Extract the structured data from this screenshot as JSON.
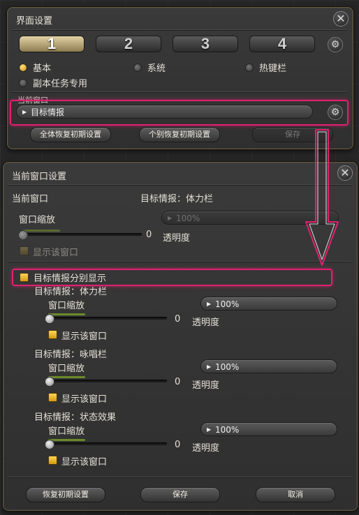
{
  "top_panel": {
    "title": "界面设置",
    "tabs": [
      "1",
      "2",
      "3",
      "4"
    ],
    "radios": [
      {
        "label": "基本",
        "selected": true
      },
      {
        "label": "系统",
        "selected": false
      },
      {
        "label": "热键栏",
        "selected": false
      },
      {
        "label": "副本任务专用",
        "selected": false
      }
    ],
    "current_window_label": "当前窗口",
    "current_window_value": "目标情报",
    "reset_all_label": "全体恢复初期设置",
    "reset_individual_label": "个别恢复初期设置",
    "save_label": "保存"
  },
  "bottom_panel": {
    "title": "当前窗口设置",
    "current_window_label": "当前窗口",
    "current_window_value": "目标情报：体力栏",
    "scale_label": "窗口缩放",
    "scale_value": "100%",
    "transparency_value": "0",
    "transparency_label": "透明度",
    "show_window_label": "显示该窗口",
    "separate_display_label": "目标情报分别显示",
    "sections": [
      {
        "title": "目标情报：体力栏",
        "scale_label": "窗口缩放",
        "scale_value": "100%",
        "transparency_value": "0",
        "transparency_label": "透明度",
        "show_label": "显示该窗口"
      },
      {
        "title": "目标情报：咏唱栏",
        "scale_label": "窗口缩放",
        "scale_value": "100%",
        "transparency_value": "0",
        "transparency_label": "透明度",
        "show_label": "显示该窗口"
      },
      {
        "title": "目标情报：状态效果",
        "scale_label": "窗口缩放",
        "scale_value": "100%",
        "transparency_value": "0",
        "transparency_label": "透明度",
        "show_label": "显示该窗口"
      }
    ],
    "reset_label": "恢复初期设置",
    "save_label": "保存",
    "cancel_label": "取消"
  },
  "colors": {
    "highlight": "#e2206f",
    "accent": "#d6a62a"
  }
}
